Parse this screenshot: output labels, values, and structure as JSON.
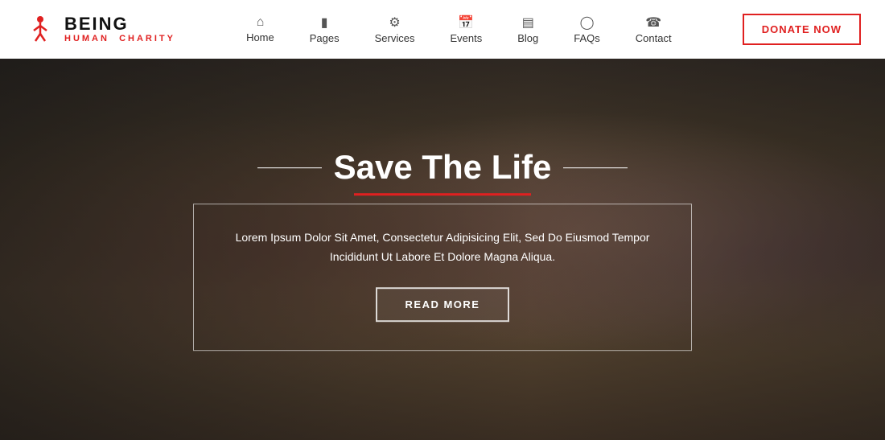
{
  "header": {
    "logo": {
      "brand": "BEING",
      "sub_line1": "HUMAN",
      "sub_line2": "CHARITY"
    },
    "nav": [
      {
        "id": "home",
        "label": "Home",
        "icon": "🏠"
      },
      {
        "id": "pages",
        "label": "Pages",
        "icon": "📄"
      },
      {
        "id": "services",
        "label": "Services",
        "icon": "⚙️"
      },
      {
        "id": "events",
        "label": "Events",
        "icon": "📅"
      },
      {
        "id": "blog",
        "label": "Blog",
        "icon": "📰"
      },
      {
        "id": "faqs",
        "label": "FAQs",
        "icon": "💬"
      },
      {
        "id": "contact",
        "label": "Contact",
        "icon": "📞"
      }
    ],
    "donate_button": "DONATE NOW"
  },
  "hero": {
    "title": "Save The Life",
    "description": "Lorem Ipsum Dolor Sit Amet, Consectetur Adipisicing Elit, Sed Do Eiusmod Tempor\nIncididunt Ut Labore Et Dolore Magna Aliqua.",
    "cta_button": "READ MORE",
    "accent_color": "#e02020"
  }
}
